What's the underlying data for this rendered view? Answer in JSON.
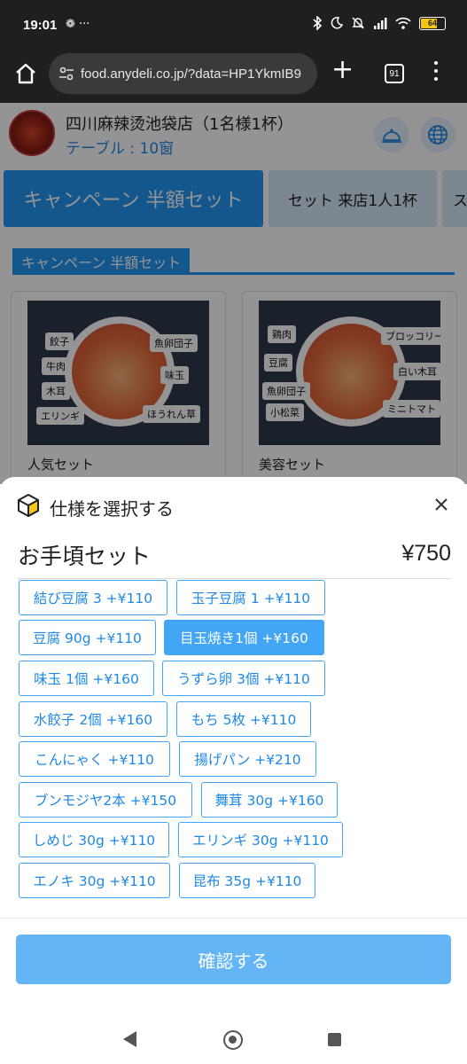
{
  "status_bar": {
    "time": "19:01",
    "left_icons": "❁ ···",
    "battery": "64"
  },
  "browser": {
    "url": "food.anydeli.co.jp/?data=HP1YkmIB9",
    "tab_count": "91",
    "new_tab": "+"
  },
  "store": {
    "name": "四川麻辣烫池袋店（1名様1杯）",
    "table": "テーブル : 10窗"
  },
  "category_tabs": [
    {
      "label": "キャンペーン 半額セット",
      "active": true
    },
    {
      "label": "セット 来店1人1杯",
      "active": false
    },
    {
      "label": "ス",
      "active": false
    }
  ],
  "section": {
    "title": "キャンペーン 半額セット"
  },
  "products": [
    {
      "name": "人気セット",
      "tags": [
        "餃子",
        "魚卵団子",
        "牛肉",
        "味玉",
        "木耳",
        "エリンギ",
        "ほうれん草"
      ]
    },
    {
      "name": "美容セット",
      "tags": [
        "鶏肉",
        "ブロッコリー",
        "豆腐",
        "白い木耳",
        "魚卵団子",
        "小松菜",
        "ミニトマト"
      ]
    }
  ],
  "sheet": {
    "title": "仕様を選択する",
    "product_name": "お手頃セット",
    "price": "¥750",
    "confirm_label": "確認する",
    "options": [
      {
        "label": "結び豆腐 3 +¥110",
        "selected": false
      },
      {
        "label": "玉子豆腐 1 +¥110",
        "selected": false
      },
      {
        "label": "豆腐 90g +¥110",
        "selected": false
      },
      {
        "label": "目玉焼き1個 +¥160",
        "selected": true
      },
      {
        "label": "味玉 1個 +¥160",
        "selected": false
      },
      {
        "label": "うずら卵 3個 +¥110",
        "selected": false
      },
      {
        "label": "水餃子 2個 +¥160",
        "selected": false
      },
      {
        "label": "もち 5枚 +¥110",
        "selected": false
      },
      {
        "label": "こんにゃく +¥110",
        "selected": false
      },
      {
        "label": "揚げパン +¥210",
        "selected": false
      },
      {
        "label": "ブンモジヤ2本 +¥150",
        "selected": false
      },
      {
        "label": "舞茸 30g +¥160",
        "selected": false
      },
      {
        "label": "しめじ 30g +¥110",
        "selected": false
      },
      {
        "label": "エリンギ 30g +¥110",
        "selected": false
      },
      {
        "label": "エノキ 30g +¥110",
        "selected": false
      },
      {
        "label": "昆布 35g +¥110",
        "selected": false
      }
    ]
  },
  "colors": {
    "accent": "#2196f3",
    "option_border": "#42a5f5",
    "confirm": "#64b5f6"
  }
}
